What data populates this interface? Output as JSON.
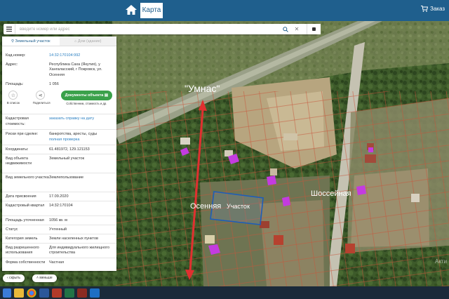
{
  "topbar": {
    "map_tab": "Карта",
    "cart_label": "Заказ"
  },
  "search": {
    "placeholder": "введите номер или адрес"
  },
  "panel": {
    "tabs": [
      {
        "label": "Земельный участок"
      },
      {
        "label": "Дом (здание)"
      }
    ],
    "fields": [
      {
        "label": "Кад.номер:",
        "value": "14:32:170104:992"
      },
      {
        "label": "Адрес:",
        "value": "Республика Саха (Якутия), у Хангаласский, г Покровск, ул. Осенняя"
      },
      {
        "label": "Площадь:",
        "value": "1 056"
      }
    ],
    "actions": {
      "list": "В список",
      "share": "Поделиться"
    },
    "doc_button": {
      "label": "Документы объекта",
      "sub": "Собственник, стоимость и др."
    },
    "cadastral_cost": {
      "label": "Кадастровая стоимость:",
      "value": "заказать справку на дату"
    },
    "risks": {
      "label": "Риски при сделке:",
      "value": "банкротства, аресты, суды",
      "link": "полная проверка"
    },
    "coords": {
      "label": "Координаты:",
      "value": "61.481972, 129.121153"
    },
    "details": [
      {
        "label": "Вид объекта недвижимости",
        "value": "Земельный участок"
      },
      {
        "label": "Вид земельного участка",
        "value": "Землепользование"
      },
      {
        "label": "Дата присвоения",
        "value": "17.09.2020"
      },
      {
        "label": "Кадастровый квартал",
        "value": "14:32:170104"
      },
      {
        "label": "Площадь уточненная",
        "value": "1056 кв. м"
      },
      {
        "label": "Статус",
        "value": "Учтенный"
      },
      {
        "label": "Категория земель",
        "value": "Земли населенных пунктов"
      },
      {
        "label": "Вид разрешенного использования",
        "value": "Для индивидуального жилищного строительства"
      },
      {
        "label": "Форма собственности",
        "value": "Частная"
      }
    ],
    "bottom_buttons": {
      "hide": "скрыть",
      "less": "меньше"
    }
  },
  "map_labels": {
    "umnas": "\"Умнас\"",
    "osennyaya": "Осенняя",
    "uchastok": "Участок",
    "shosseynaya": "Шоссейная",
    "watermark": "Акти"
  },
  "colors": {
    "topbar": "#1f5f8d",
    "doc_button": "#3aa14a",
    "arrow": "#e03030",
    "parcel_outline": "#1e5db8",
    "buildings": "#c43be0"
  }
}
